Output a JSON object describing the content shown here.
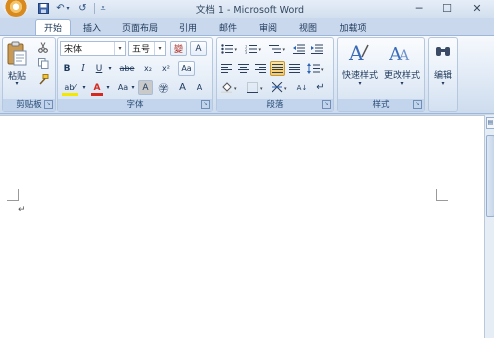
{
  "window": {
    "title": "文档 1 - Microsoft Word",
    "quick_access": {
      "undo_icon": "↶",
      "redo_icon": "↺",
      "customize_icon": "⩡"
    },
    "controls": {
      "minimize": "─",
      "maximize": "☐",
      "close": "✕"
    }
  },
  "tabs": [
    {
      "label": "开始",
      "active": true
    },
    {
      "label": "插入"
    },
    {
      "label": "页面布局"
    },
    {
      "label": "引用"
    },
    {
      "label": "邮件"
    },
    {
      "label": "审阅"
    },
    {
      "label": "视图"
    },
    {
      "label": "加载项"
    }
  ],
  "ribbon": {
    "clipboard": {
      "label": "剪贴板",
      "paste_label": "粘贴",
      "paste_arrow": "▾"
    },
    "font": {
      "label": "字体",
      "font_name": "宋体",
      "font_size": "五号",
      "wen_glyph": "變",
      "clear_format": "A",
      "bold": "B",
      "italic": "I",
      "underline": "U",
      "strike": "abe",
      "subscript": "x₂",
      "superscript": "x²",
      "change_case": "Aa",
      "char_shading": "A",
      "enclose": "㊫",
      "grow": "A",
      "shrink": "A",
      "phonetic": "字",
      "font_color": "A",
      "highlight": "ab⁄",
      "font_color_hex": "#d6281e",
      "highlight_hex": "#f5e800"
    },
    "paragraph": {
      "label": "段落",
      "sort_icon": "A↓",
      "show_marks": "↵"
    },
    "styles": {
      "label": "样式",
      "quick_styles": "快速样式",
      "change_styles": "更改样式"
    },
    "editing": {
      "label": "编辑"
    }
  },
  "document": {
    "paragraph_mark": "↵"
  }
}
